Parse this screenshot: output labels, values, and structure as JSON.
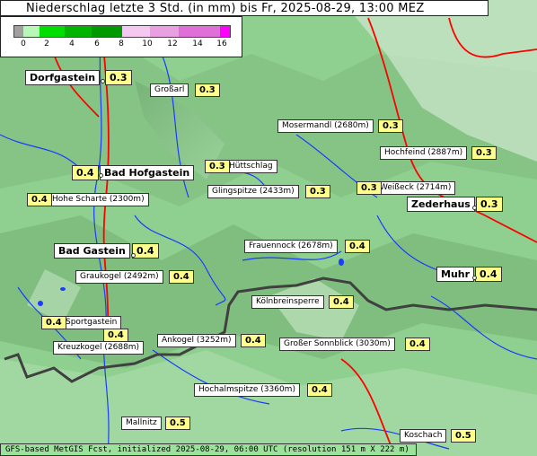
{
  "title": "Niederschlag letzte 3 Std. (in mm) bis Fr, 2025-08-29, 13:00 MEZ",
  "legend": {
    "ticks": [
      "0",
      "2",
      "4",
      "6",
      "8",
      "10",
      "12",
      "14",
      "16"
    ],
    "colors": [
      "#a0a0a0",
      "#b8f7b8",
      "#00dd00",
      "#00b400",
      "#009a00",
      "#f4c8f0",
      "#e8a0e0",
      "#e070d8",
      "#ff00ff"
    ]
  },
  "places": [
    {
      "name": "Dorfgastein",
      "value": "0.3",
      "big": true
    },
    {
      "name": "Großarl",
      "value": "0.3"
    },
    {
      "name": "Mosermandl (2680m)",
      "value": "0.3"
    },
    {
      "name": "Hochfeind (2887m)",
      "value": "0.3"
    },
    {
      "name": "Bad Hofgastein",
      "value": "0.4",
      "big": true
    },
    {
      "name": "Hüttschlag",
      "value": "0.3"
    },
    {
      "name": "Glingspitze (2433m)",
      "value": "0.3"
    },
    {
      "name": "Weißeck (2714m)",
      "value": "0.3"
    },
    {
      "name": "Zederhaus",
      "value": "0.3",
      "big": true
    },
    {
      "name": "Hohe Scharte (2300m)",
      "value": "0.4"
    },
    {
      "name": "Frauennock (2678m)",
      "value": "0.4"
    },
    {
      "name": "Bad Gastein",
      "value": "0.4",
      "big": true
    },
    {
      "name": "Graukogel (2492m)",
      "value": "0.4"
    },
    {
      "name": "Muhr",
      "value": "0.4",
      "big": true
    },
    {
      "name": "Kölnbreinsperre",
      "value": "0.4"
    },
    {
      "name": "Sportgastein",
      "value": "0.4"
    },
    {
      "name": "Kreuzkogel (2688m)",
      "value": "0.4"
    },
    {
      "name": "Ankogel (3252m)",
      "value": "0.4"
    },
    {
      "name": "Großer Sonnblick (3030m)",
      "value": "0.4"
    },
    {
      "name": "Hochalmspitze (3360m)",
      "value": "0.4"
    },
    {
      "name": "Mallnitz",
      "value": "0.5"
    },
    {
      "name": "Koschach",
      "value": "0.5"
    }
  ],
  "footer": "GFS-based MetGIS Fcst, initialized 2025-08-29, 06:00 UTC  (resolution 151 m X 222 m)",
  "colors": {
    "terrain": "#8fcf8f",
    "river": "#1a3cff",
    "road": "#ff0000",
    "border": "#404040",
    "label_value_bg": "#ffff8c"
  }
}
